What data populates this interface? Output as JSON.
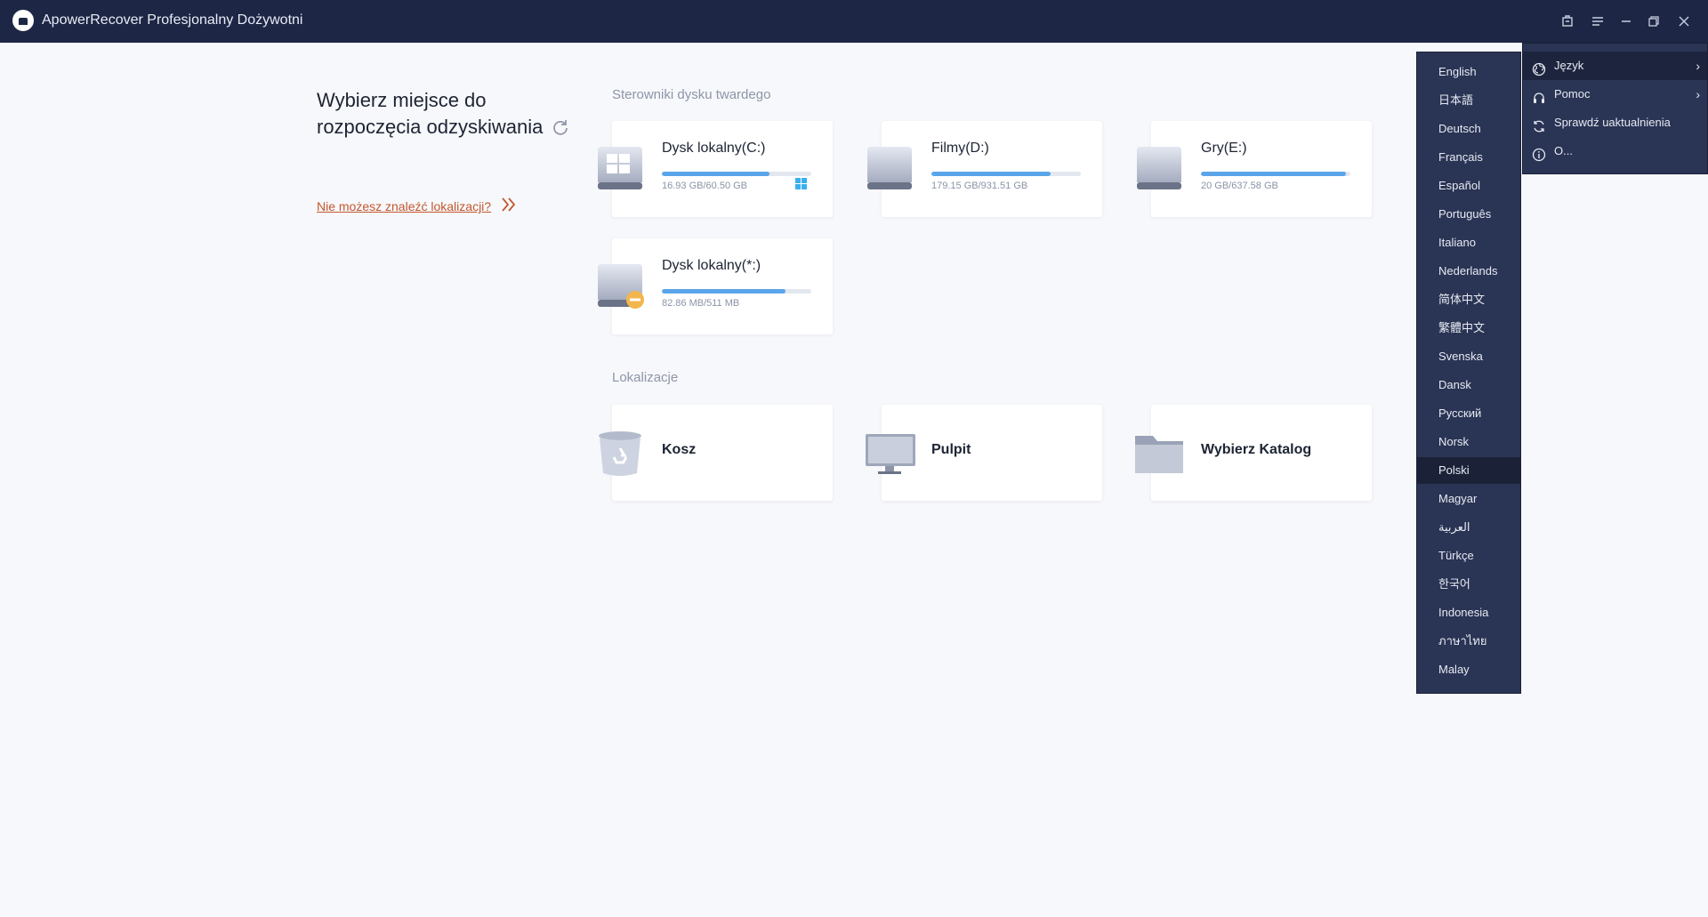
{
  "app": {
    "title": "ApowerRecover Profesjonalny Dożywotni",
    "controls": [
      "toolbox-icon",
      "menu-icon",
      "minimize-icon",
      "restore-icon",
      "close-icon"
    ]
  },
  "left_panel": {
    "heading_line1": "Wybierz miejsce do",
    "heading_line2": "rozpoczęcia odzyskiwania",
    "cant_find_link": "Nie możesz znaleźć lokalizacji?"
  },
  "drives": {
    "section_label": "Sterowniki dysku twardego",
    "items": [
      {
        "name": "Dysk lokalny(C:)",
        "size": "16.93 GB/60.50 GB",
        "used_fraction": 0.72,
        "system": true
      },
      {
        "name": "Filmy(D:)",
        "size": "179.15 GB/931.51 GB",
        "used_fraction": 0.8,
        "system": false
      },
      {
        "name": "Gry(E:)",
        "size": "20 GB/637.58 GB",
        "used_fraction": 0.97,
        "system": false
      },
      {
        "name": "Dysk lokalny(*:)",
        "size": "82.86 MB/511 MB",
        "used_fraction": 0.83,
        "system": false
      }
    ]
  },
  "locations": {
    "section_label": "Lokalizacje",
    "items": [
      {
        "name": "Kosz",
        "icon": "recycle-bin-icon"
      },
      {
        "name": "Pulpit",
        "icon": "desktop-icon"
      },
      {
        "name": "Wybierz Katalog",
        "icon": "folder-icon"
      }
    ]
  },
  "language_menu": {
    "selected": "Polski",
    "items": [
      "English",
      "日本語",
      "Deutsch",
      "Français",
      "Español",
      "Português",
      "Italiano",
      "Nederlands",
      "简体中文",
      "繁體中文",
      "Svenska",
      "Dansk",
      "Русский",
      "Norsk",
      "Polski",
      "Magyar",
      "العربية",
      "Türkçe",
      "한국어",
      "Indonesia",
      "ภาษาไทย",
      "Malay"
    ]
  },
  "settings_menu": {
    "items": [
      {
        "label": "Język",
        "icon": "globe-icon",
        "submenu": true
      },
      {
        "label": "Pomoc",
        "icon": "headset-icon",
        "submenu": true
      },
      {
        "label": "Sprawdź uaktualnienia",
        "icon": "update-icon",
        "submenu": false
      },
      {
        "label": "O...",
        "icon": "info-icon",
        "submenu": false
      }
    ]
  },
  "colors": {
    "titlebar": "#1d2644",
    "menu_bg": "#2a3454",
    "accent_bar": "#5aa5ea",
    "link": "#c2572e"
  }
}
